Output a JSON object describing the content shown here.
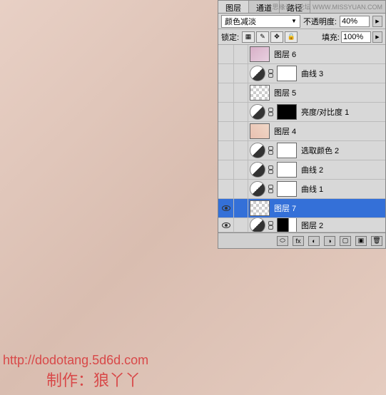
{
  "tabs": {
    "layers": "图层",
    "channels": "通道",
    "paths": "路径"
  },
  "watermark": "思缘设计论坛 WWW.MISSYUAN.COM",
  "toolbar": {
    "blend_mode": "颜色减淡",
    "opacity_label": "不透明度:",
    "opacity_value": "40%",
    "lock_label": "锁定:",
    "fill_label": "填充:",
    "fill_value": "100%"
  },
  "layers": [
    {
      "name": "图层 6",
      "type": "image",
      "thumb": "img1",
      "visible": false
    },
    {
      "name": "曲线 3",
      "type": "adj",
      "mask": "white",
      "visible": false
    },
    {
      "name": "图层 5",
      "type": "image",
      "thumb": "checker",
      "visible": false
    },
    {
      "name": "亮度/对比度 1",
      "type": "adj",
      "mask": "black",
      "visible": false
    },
    {
      "name": "图层 4",
      "type": "image",
      "thumb": "img2",
      "visible": false
    },
    {
      "name": "选取颜色 2",
      "type": "adj",
      "mask": "white",
      "visible": false
    },
    {
      "name": "曲线 2",
      "type": "adj",
      "mask": "white",
      "visible": false
    },
    {
      "name": "曲线 1",
      "type": "adj",
      "mask": "white",
      "visible": false
    },
    {
      "name": "图层 7",
      "type": "image",
      "thumb": "checker",
      "visible": true,
      "selected": true
    },
    {
      "name": "图层 2",
      "type": "adj-partial",
      "mask": "part",
      "visible": true
    }
  ],
  "footer": {
    "url": "http://dodotang.5d6d.com",
    "credit": "制作：狼丫丫"
  }
}
